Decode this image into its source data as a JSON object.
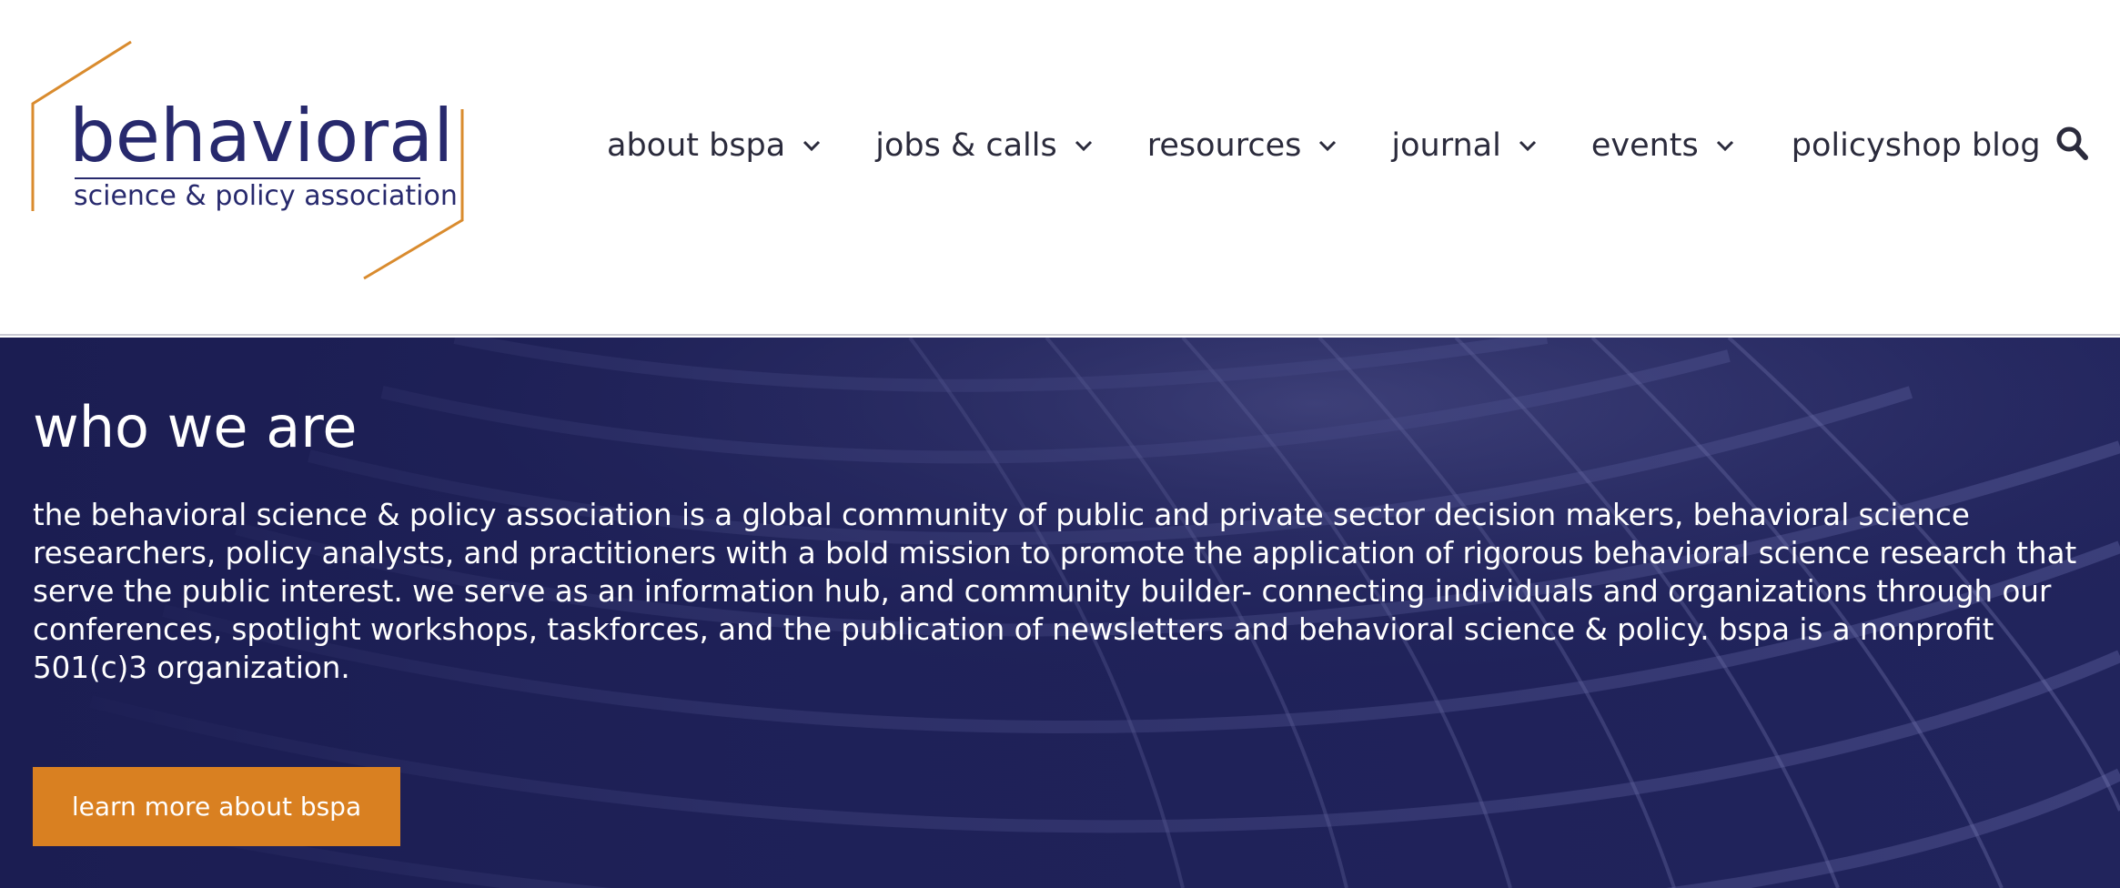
{
  "logo": {
    "title": "behavioral",
    "subtitle": "science & policy association",
    "accent_color": "#d98b2e",
    "text_color": "#27296d"
  },
  "nav": {
    "items": [
      {
        "label": "about bspa",
        "has_dropdown": true
      },
      {
        "label": "jobs & calls",
        "has_dropdown": true
      },
      {
        "label": "resources",
        "has_dropdown": true
      },
      {
        "label": "journal",
        "has_dropdown": true
      },
      {
        "label": "events",
        "has_dropdown": true
      },
      {
        "label": "policyshop blog",
        "has_dropdown": false
      }
    ],
    "search_icon": "search-icon"
  },
  "hero": {
    "title": "who we are",
    "text": "the behavioral science & policy association is a global community of public and private sector decision makers, behavioral science researchers, policy analysts, and practitioners with a bold mission to promote the application of rigorous behavioral science research that serve the public interest. we serve as an information hub, and community builder- connecting individuals and organizations through our conferences, spotlight workshops, taskforces, and the publication of newsletters and behavioral science & policy. bspa is a nonprofit 501(c)3 organization.",
    "cta_label": "learn more about bspa",
    "background_color": "#1f2158",
    "cta_color": "#d98021"
  }
}
